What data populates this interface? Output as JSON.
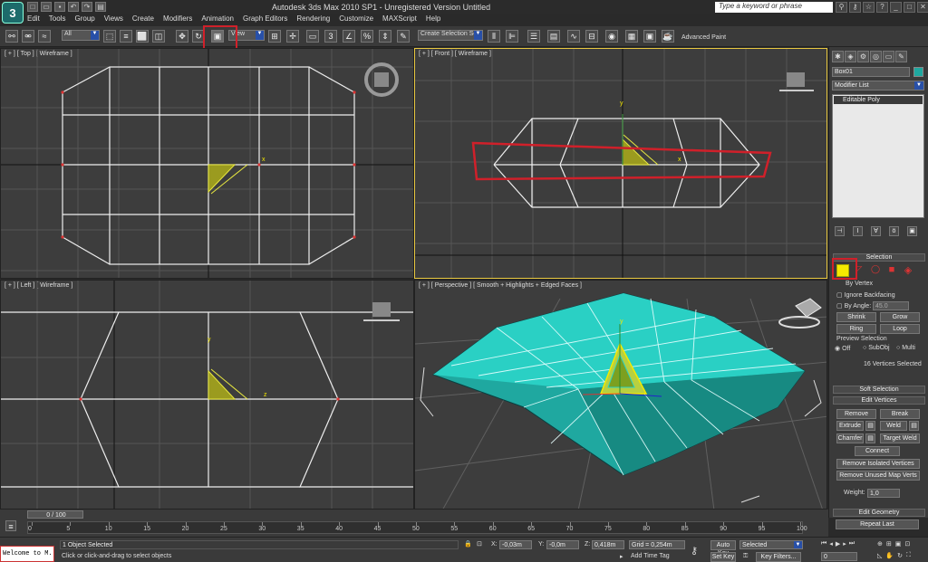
{
  "app": {
    "title": "Autodesk 3ds Max  2010 SP1  -  Unregistered Version    Untitled",
    "logo": "3",
    "search_placeholder": "Type a keyword or phrase"
  },
  "menu": [
    "Edit",
    "Tools",
    "Group",
    "Views",
    "Create",
    "Modifiers",
    "Animation",
    "Graph Editors",
    "Rendering",
    "Customize",
    "MAXScript",
    "Help"
  ],
  "toolbar": {
    "filter_value": "All",
    "ref_coord_value": "View",
    "selection_set_value": "Create Selection Se",
    "advanced_paint": "Advanced Paint",
    "percent_label": "%",
    "angle_label": "3"
  },
  "viewports": {
    "top": "[ + ] [ Top ] [ Wireframe ]",
    "front": "[ + ] [ Front ] [ Wireframe ]",
    "left": "[ + ] [ Left ] [ Wireframe ]",
    "perspective": "[ + ] [ Perspective ] [ Smooth + Highlights + Edged Faces ]"
  },
  "axes": {
    "x": "x",
    "y": "y",
    "z": "z"
  },
  "command_panel": {
    "object_name": "Box01",
    "modifier_list": "Modifier List",
    "modifier_stack_item": "Editable Poly",
    "selection_header": "Selection",
    "by_vertex_label": "By Vertex",
    "ignore_backfacing": "Ignore Backfacing",
    "by_angle_label": "By Angle:",
    "by_angle_value": "45.0",
    "shrink": "Shrink",
    "grow": "Grow",
    "ring": "Ring",
    "loop": "Loop",
    "preview_selection": "Preview Selection",
    "off": "Off",
    "subobj": "SubObj",
    "multi": "Multi",
    "vertices_selected": "16 Vertices Selected",
    "soft_selection": "Soft Selection",
    "edit_vertices": "Edit Vertices",
    "remove": "Remove",
    "break": "Break",
    "extrude": "Extrude",
    "weld": "Weld",
    "chamfer": "Chamfer",
    "target_weld": "Target Weld",
    "connect": "Connect",
    "remove_isolated": "Remove Isolated Vertices",
    "remove_unused": "Remove Unused Map Verts",
    "weight_label": "Weight:",
    "weight_value": "1,0",
    "edit_geometry": "Edit Geometry",
    "repeat_last": "Repeat Last"
  },
  "timeline": {
    "frame_display": "0 / 100",
    "ticks": [
      "0",
      "5",
      "10",
      "15",
      "20",
      "25",
      "30",
      "35",
      "40",
      "45",
      "50",
      "55",
      "60",
      "65",
      "70",
      "75",
      "80",
      "85",
      "90",
      "95",
      "100"
    ]
  },
  "status": {
    "maxscript_listener": "Welcome to M.",
    "selected_count": "1 Object Selected",
    "prompt": "Click or click-and-drag to select objects",
    "x_label": "X:",
    "x_value": "-0,03m",
    "y_label": "Y:",
    "y_value": "-0,0m",
    "z_label": "Z:",
    "z_value": "0,418m",
    "grid": "Grid = 0,254m",
    "add_time_tag": "Add Time Tag",
    "auto_key": "Auto Key",
    "set_key": "Set Key",
    "selected_dropdown": "Selected",
    "key_filters": "Key Filters...",
    "frame_value": "0"
  },
  "colors": {
    "box_teal": "#1fa8a0",
    "wire": "#e8e8e8",
    "highlight_red": "#d0202a",
    "vertex_yellow": "#f5e900"
  }
}
